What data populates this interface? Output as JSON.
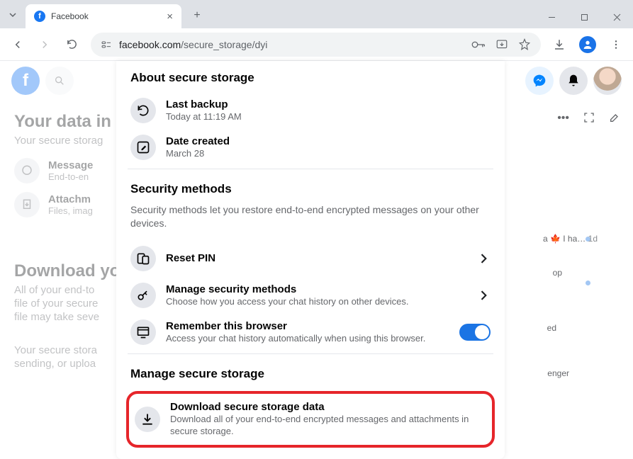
{
  "browser": {
    "tab_title": "Facebook",
    "url_domain": "facebook.com",
    "url_path": "/secure_storage/dyi"
  },
  "fb_header": {
    "logo": "f"
  },
  "background": {
    "heading": "Your data in se",
    "subheading": "Your secure storag",
    "row1_title": "Message",
    "row1_sub": "End-to-en",
    "row2_title": "Attachm",
    "row2_sub": "Files, imag",
    "download_heading": "Download you",
    "download_line1": "All of your end-to",
    "download_line2": "file of your secure",
    "download_line3": "file may take seve",
    "download_line4": "Your secure stora",
    "download_line5": "sending, or uploa",
    "chat1_text": "a 🍁 I ha…",
    "chat1_time": "1d",
    "chat2_text": "op",
    "right_text_1": "ed",
    "right_text_2": "enger"
  },
  "panel": {
    "about_title": "About secure storage",
    "backup_title": "Last backup",
    "backup_sub": "Today at 11:19 AM",
    "created_title": "Date created",
    "created_sub": "March 28",
    "security_title": "Security methods",
    "security_desc": "Security methods let you restore end-to-end encrypted messages on your other devices.",
    "reset_pin": "Reset PIN",
    "manage_methods_title": "Manage security methods",
    "manage_methods_sub": "Choose how you access your chat history on other devices.",
    "remember_title": "Remember this browser",
    "remember_sub": "Access your chat history automatically when using this browser.",
    "manage_storage_title": "Manage secure storage",
    "download_title": "Download secure storage data",
    "download_sub": "Download all of your end-to-end encrypted messages and attachments in secure storage."
  }
}
